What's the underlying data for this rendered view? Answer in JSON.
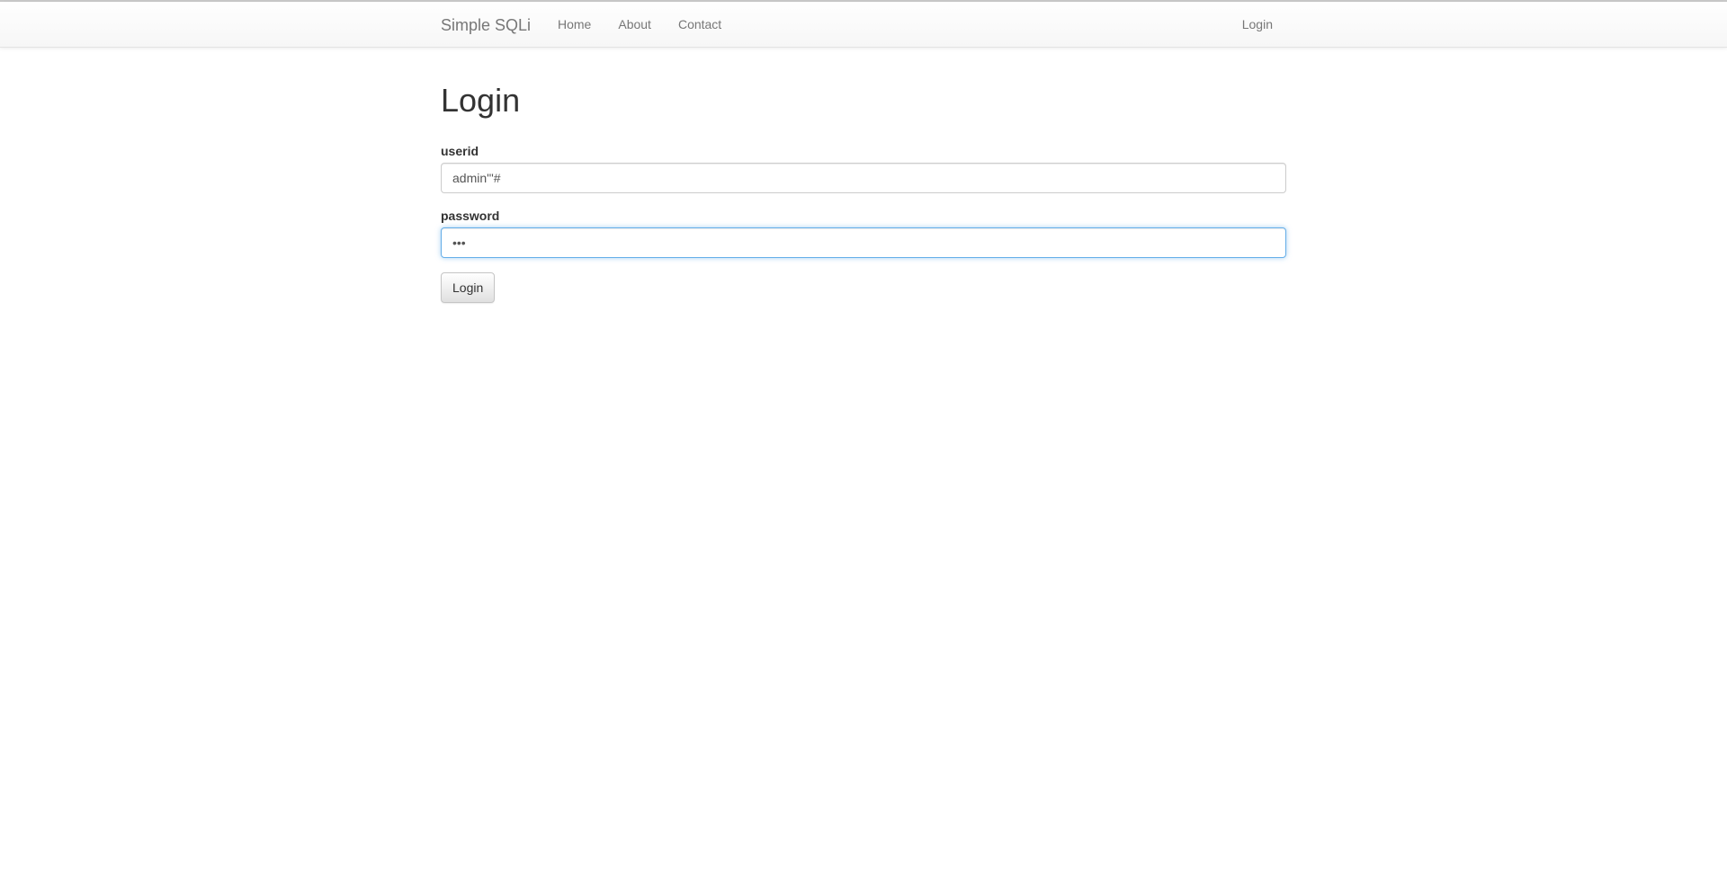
{
  "navbar": {
    "brand": "Simple SQLi",
    "links": [
      "Home",
      "About",
      "Contact"
    ],
    "right_link": "Login"
  },
  "page": {
    "title": "Login"
  },
  "form": {
    "userid_label": "userid",
    "userid_value": "admin'\"#",
    "password_label": "password",
    "password_value": "abc",
    "submit_label": "Login"
  }
}
